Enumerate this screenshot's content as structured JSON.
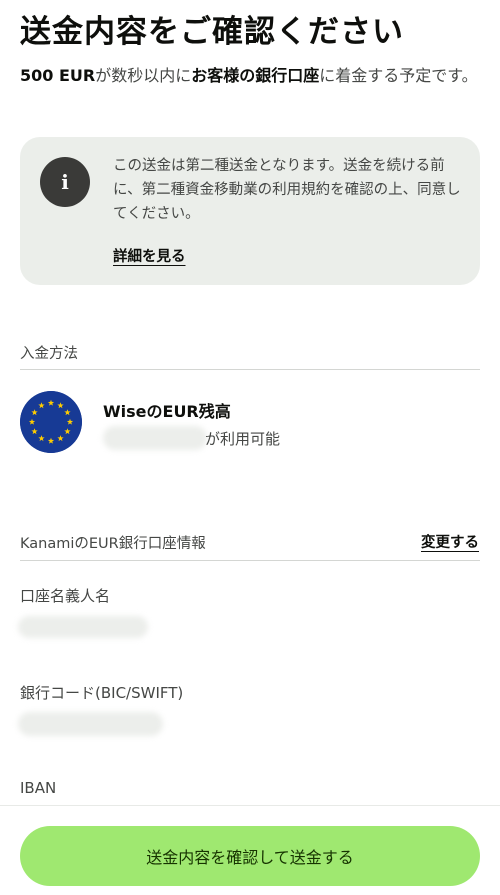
{
  "page_title": "送金内容をご確認ください",
  "summary": {
    "amount": "500 EUR",
    "text_after_amount": "が数秒以内に",
    "destination": "お客様の銀行口座",
    "text_end": "に着金する予定です。"
  },
  "notice": {
    "icon": "info-icon",
    "icon_glyph": "i",
    "text": "この送金は第二種送金となります。送金を続ける前に、第二種資金移動業の利用規約を確認の上、同意してください。",
    "link": "詳細を見る"
  },
  "payment_method": {
    "section_label": "入金方法",
    "name": "WiseのEUR残高",
    "availability_suffix": "が利用可能",
    "flag_icon": "eu-flag-icon"
  },
  "bank_details": {
    "section_label": "KanamiのEUR銀行口座情報",
    "change_link": "変更する",
    "fields": [
      {
        "label": "口座名義人名"
      },
      {
        "label": "銀行コード(BIC/SWIFT)"
      },
      {
        "label": "IBAN"
      }
    ]
  },
  "cta": {
    "label": "送金内容を確認して送金する"
  },
  "colors": {
    "primary_green": "#9fe870",
    "cta_text": "#163300",
    "notice_bg": "#ebeeea",
    "flag_blue": "#173a95",
    "flag_star": "#ffcc00"
  }
}
